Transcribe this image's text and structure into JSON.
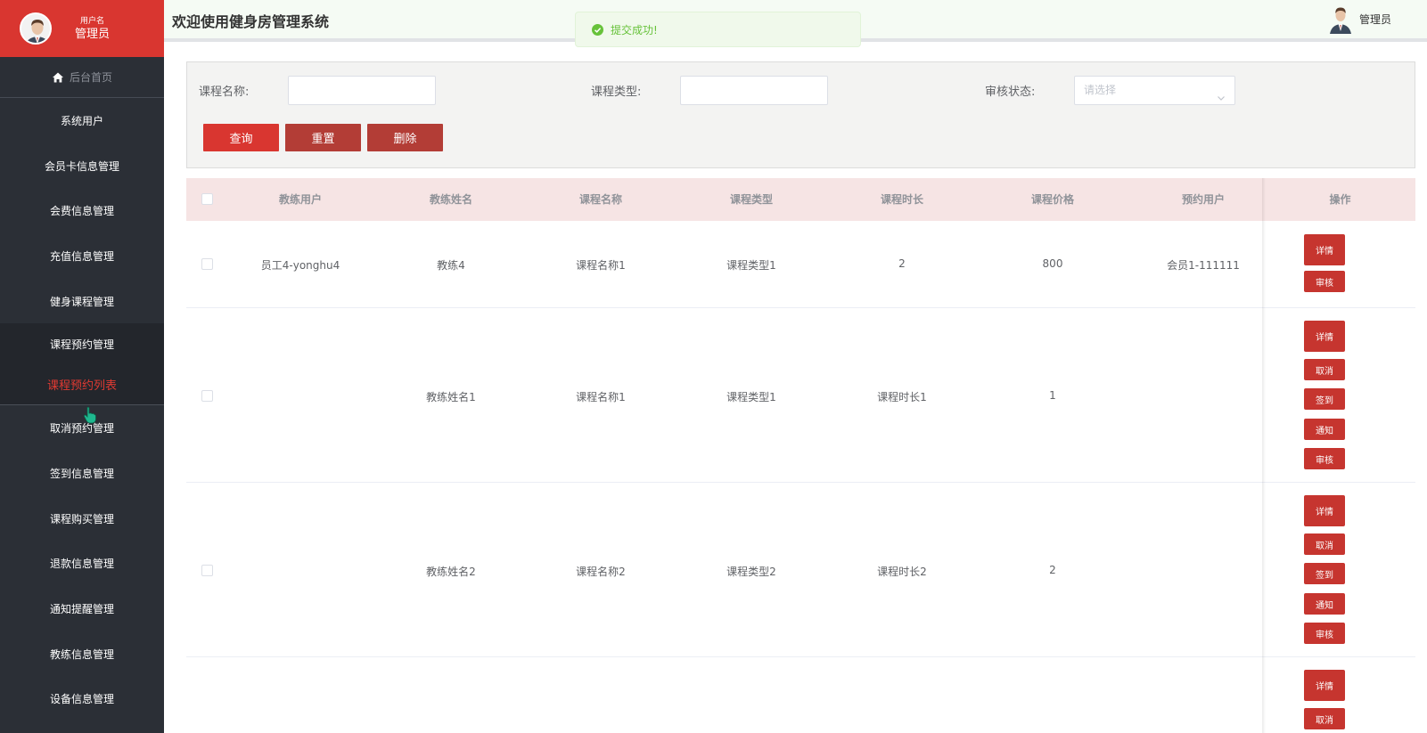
{
  "sidebar": {
    "user_label": "用户名",
    "user_name": "管理员",
    "home": "后台首页",
    "items_top": [
      "系统用户",
      "会员卡信息管理",
      "会费信息管理",
      "充值信息管理",
      "健身课程管理"
    ],
    "open_item": "课程预约管理",
    "sub_item": "课程预约列表",
    "items_bottom": [
      "取消预约管理",
      "签到信息管理",
      "课程购买管理",
      "退款信息管理",
      "通知提醒管理",
      "教练信息管理",
      "设备信息管理"
    ]
  },
  "header": {
    "title": "欢迎使用健身房管理系统",
    "user": "管理员"
  },
  "toast": {
    "message": "提交成功!"
  },
  "search": {
    "course_name_label": "课程名称:",
    "course_type_label": "课程类型:",
    "audit_status_label": "审核状态:",
    "audit_status_placeholder": "请选择",
    "btn_query": "查询",
    "btn_reset": "重置",
    "btn_delete": "删除"
  },
  "table": {
    "columns": [
      "教练用户",
      "教练姓名",
      "课程名称",
      "课程类型",
      "课程时长",
      "课程价格",
      "预约用户",
      "操作"
    ],
    "rows": [
      {
        "coach_user": "员工4-yonghu4",
        "coach_name": "教练4",
        "course_name": "课程名称1",
        "course_type": "课程类型1",
        "duration": "2",
        "price": "800",
        "member": "会员1-111111",
        "actions": [
          "详情",
          "审核"
        ]
      },
      {
        "coach_user": "",
        "coach_name": "教练姓名1",
        "course_name": "课程名称1",
        "course_type": "课程类型1",
        "duration": "课程时长1",
        "price": "1",
        "member": "",
        "actions": [
          "详情",
          "取消",
          "签到",
          "通知",
          "审核"
        ]
      },
      {
        "coach_user": "",
        "coach_name": "教练姓名2",
        "course_name": "课程名称2",
        "course_type": "课程类型2",
        "duration": "课程时长2",
        "price": "2",
        "member": "",
        "actions": [
          "详情",
          "取消",
          "签到",
          "通知",
          "审核"
        ]
      },
      {
        "coach_user": "",
        "coach_name": "",
        "course_name": "",
        "course_type": "",
        "duration": "",
        "price": "",
        "member": "",
        "actions": [
          "详情",
          "取消"
        ]
      }
    ]
  }
}
